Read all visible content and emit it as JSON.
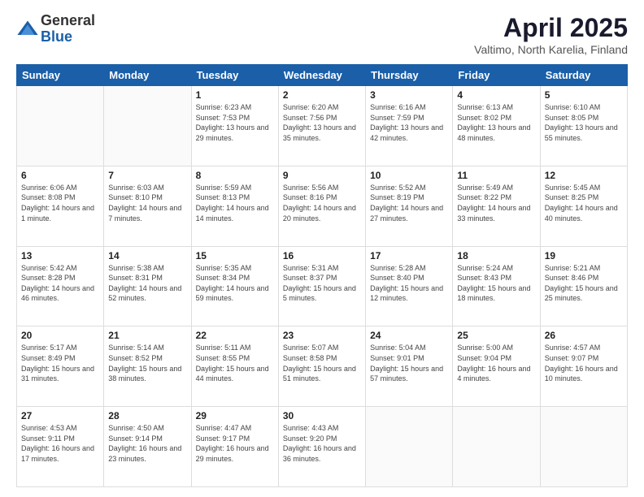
{
  "header": {
    "logo_general": "General",
    "logo_blue": "Blue",
    "main_title": "April 2025",
    "subtitle": "Valtimo, North Karelia, Finland"
  },
  "calendar": {
    "days_of_week": [
      "Sunday",
      "Monday",
      "Tuesday",
      "Wednesday",
      "Thursday",
      "Friday",
      "Saturday"
    ],
    "weeks": [
      [
        {
          "day": "",
          "info": ""
        },
        {
          "day": "",
          "info": ""
        },
        {
          "day": "1",
          "info": "Sunrise: 6:23 AM\nSunset: 7:53 PM\nDaylight: 13 hours and 29 minutes."
        },
        {
          "day": "2",
          "info": "Sunrise: 6:20 AM\nSunset: 7:56 PM\nDaylight: 13 hours and 35 minutes."
        },
        {
          "day": "3",
          "info": "Sunrise: 6:16 AM\nSunset: 7:59 PM\nDaylight: 13 hours and 42 minutes."
        },
        {
          "day": "4",
          "info": "Sunrise: 6:13 AM\nSunset: 8:02 PM\nDaylight: 13 hours and 48 minutes."
        },
        {
          "day": "5",
          "info": "Sunrise: 6:10 AM\nSunset: 8:05 PM\nDaylight: 13 hours and 55 minutes."
        }
      ],
      [
        {
          "day": "6",
          "info": "Sunrise: 6:06 AM\nSunset: 8:08 PM\nDaylight: 14 hours and 1 minute."
        },
        {
          "day": "7",
          "info": "Sunrise: 6:03 AM\nSunset: 8:10 PM\nDaylight: 14 hours and 7 minutes."
        },
        {
          "day": "8",
          "info": "Sunrise: 5:59 AM\nSunset: 8:13 PM\nDaylight: 14 hours and 14 minutes."
        },
        {
          "day": "9",
          "info": "Sunrise: 5:56 AM\nSunset: 8:16 PM\nDaylight: 14 hours and 20 minutes."
        },
        {
          "day": "10",
          "info": "Sunrise: 5:52 AM\nSunset: 8:19 PM\nDaylight: 14 hours and 27 minutes."
        },
        {
          "day": "11",
          "info": "Sunrise: 5:49 AM\nSunset: 8:22 PM\nDaylight: 14 hours and 33 minutes."
        },
        {
          "day": "12",
          "info": "Sunrise: 5:45 AM\nSunset: 8:25 PM\nDaylight: 14 hours and 40 minutes."
        }
      ],
      [
        {
          "day": "13",
          "info": "Sunrise: 5:42 AM\nSunset: 8:28 PM\nDaylight: 14 hours and 46 minutes."
        },
        {
          "day": "14",
          "info": "Sunrise: 5:38 AM\nSunset: 8:31 PM\nDaylight: 14 hours and 52 minutes."
        },
        {
          "day": "15",
          "info": "Sunrise: 5:35 AM\nSunset: 8:34 PM\nDaylight: 14 hours and 59 minutes."
        },
        {
          "day": "16",
          "info": "Sunrise: 5:31 AM\nSunset: 8:37 PM\nDaylight: 15 hours and 5 minutes."
        },
        {
          "day": "17",
          "info": "Sunrise: 5:28 AM\nSunset: 8:40 PM\nDaylight: 15 hours and 12 minutes."
        },
        {
          "day": "18",
          "info": "Sunrise: 5:24 AM\nSunset: 8:43 PM\nDaylight: 15 hours and 18 minutes."
        },
        {
          "day": "19",
          "info": "Sunrise: 5:21 AM\nSunset: 8:46 PM\nDaylight: 15 hours and 25 minutes."
        }
      ],
      [
        {
          "day": "20",
          "info": "Sunrise: 5:17 AM\nSunset: 8:49 PM\nDaylight: 15 hours and 31 minutes."
        },
        {
          "day": "21",
          "info": "Sunrise: 5:14 AM\nSunset: 8:52 PM\nDaylight: 15 hours and 38 minutes."
        },
        {
          "day": "22",
          "info": "Sunrise: 5:11 AM\nSunset: 8:55 PM\nDaylight: 15 hours and 44 minutes."
        },
        {
          "day": "23",
          "info": "Sunrise: 5:07 AM\nSunset: 8:58 PM\nDaylight: 15 hours and 51 minutes."
        },
        {
          "day": "24",
          "info": "Sunrise: 5:04 AM\nSunset: 9:01 PM\nDaylight: 15 hours and 57 minutes."
        },
        {
          "day": "25",
          "info": "Sunrise: 5:00 AM\nSunset: 9:04 PM\nDaylight: 16 hours and 4 minutes."
        },
        {
          "day": "26",
          "info": "Sunrise: 4:57 AM\nSunset: 9:07 PM\nDaylight: 16 hours and 10 minutes."
        }
      ],
      [
        {
          "day": "27",
          "info": "Sunrise: 4:53 AM\nSunset: 9:11 PM\nDaylight: 16 hours and 17 minutes."
        },
        {
          "day": "28",
          "info": "Sunrise: 4:50 AM\nSunset: 9:14 PM\nDaylight: 16 hours and 23 minutes."
        },
        {
          "day": "29",
          "info": "Sunrise: 4:47 AM\nSunset: 9:17 PM\nDaylight: 16 hours and 29 minutes."
        },
        {
          "day": "30",
          "info": "Sunrise: 4:43 AM\nSunset: 9:20 PM\nDaylight: 16 hours and 36 minutes."
        },
        {
          "day": "",
          "info": ""
        },
        {
          "day": "",
          "info": ""
        },
        {
          "day": "",
          "info": ""
        }
      ]
    ]
  }
}
